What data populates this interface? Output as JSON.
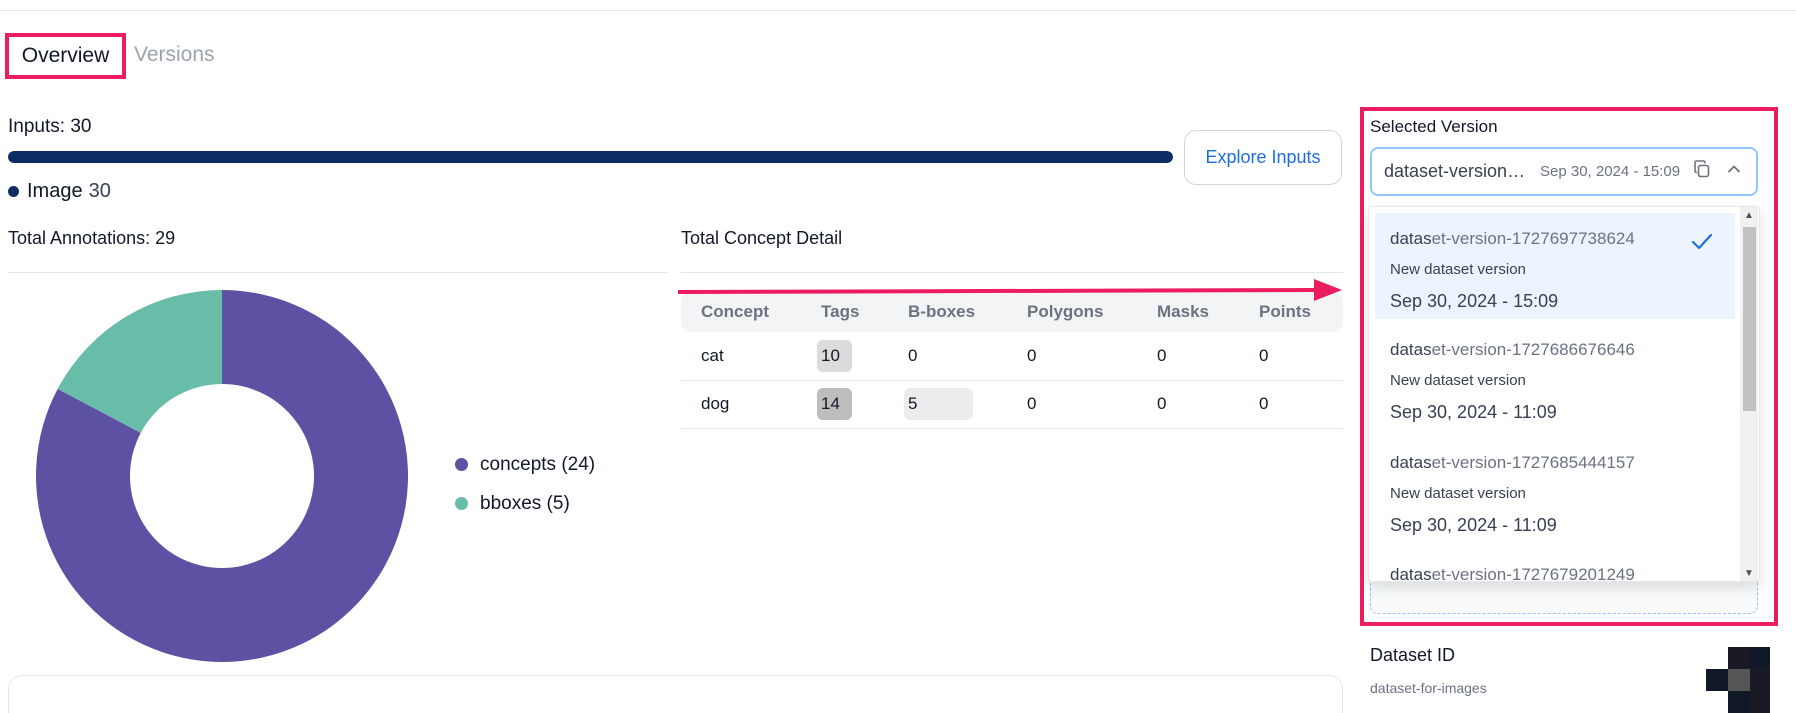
{
  "tabs": {
    "overview": "Overview",
    "versions": "Versions"
  },
  "inputs": {
    "label": "Inputs: 30",
    "progress_fraction": 1.0,
    "bar_color": "#0d2c63",
    "legend_name": "Image",
    "legend_count": "30",
    "explore_button": "Explore Inputs"
  },
  "annotations": {
    "title": "Total Annotations: 29"
  },
  "chart_data": {
    "type": "pie",
    "donut": true,
    "labels": [
      "concepts (24)",
      "bboxes (5)"
    ],
    "values": [
      24,
      5
    ],
    "colors": [
      "#5d51a3",
      "#68bda9"
    ],
    "legend_position": "right"
  },
  "concepts": {
    "title": "Total Concept Detail",
    "columns": [
      "Concept",
      "Tags",
      "B-boxes",
      "Polygons",
      "Masks",
      "Points"
    ],
    "rows": [
      [
        "cat",
        "10",
        "0",
        "0",
        "0",
        "0"
      ],
      [
        "dog",
        "14",
        "5",
        "0",
        "0",
        "0"
      ]
    ]
  },
  "selected_version": {
    "label": "Selected Version",
    "value": "dataset-version-1727697738624",
    "date": "Sep 30, 2024 - 15:09",
    "options": [
      {
        "prefix": "datas",
        "rest": "et-version-1727697738624",
        "desc": "New dataset version",
        "date": "Sep 30, 2024 - 15:09"
      },
      {
        "prefix": "datas",
        "rest": "et-version-1727686676646",
        "desc": "New dataset version",
        "date": "Sep 30, 2024 - 11:09"
      },
      {
        "prefix": "datas",
        "rest": "et-version-1727685444157",
        "desc": "New dataset version",
        "date": "Sep 30, 2024 - 11:09"
      },
      {
        "prefix": "datas",
        "rest": "et-version-1727679201249",
        "desc": "",
        "date": ""
      }
    ]
  },
  "dataset": {
    "id_label": "Dataset ID",
    "id_value": "dataset-for-images"
  },
  "colors": {
    "accent_highlight": "#ec1d5f",
    "link_blue": "#1d6fdc"
  }
}
